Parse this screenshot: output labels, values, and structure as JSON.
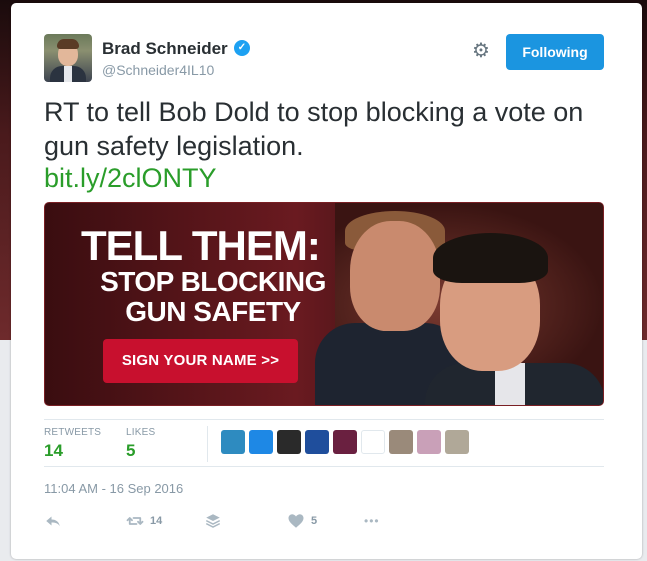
{
  "author": {
    "name": "Brad Schneider",
    "handle": "@Schneider4IL10",
    "verified_icon": "verified-badge-icon",
    "verified_glyph": "✓"
  },
  "header": {
    "settings_icon": "gear-icon",
    "settings_glyph": "⚙",
    "follow_label": "Following"
  },
  "tweet": {
    "text": "RT to tell Bob Dold to stop blocking a vote on gun safety legislation.",
    "link": "bit.ly/2clONTY"
  },
  "media": {
    "headline": "TELL THEM:",
    "subhead_line1": "STOP BLOCKING",
    "subhead_line2": "GUN SAFETY",
    "button_label": "SIGN YOUR NAME >>"
  },
  "stats": {
    "retweets_label": "RETWEETS",
    "retweets_value": "14",
    "likes_label": "LIKES",
    "likes_value": "5"
  },
  "likers": [
    {
      "name": "liker-avatar-1",
      "color": "#2e8bc0"
    },
    {
      "name": "liker-avatar-2",
      "color": "#1e88e5"
    },
    {
      "name": "liker-avatar-3",
      "color": "#2a2a2a"
    },
    {
      "name": "liker-avatar-4",
      "color": "#1f4e9c"
    },
    {
      "name": "liker-avatar-5",
      "color": "#6a2040"
    },
    {
      "name": "liker-avatar-6",
      "color": "#ffffff"
    },
    {
      "name": "liker-avatar-7",
      "color": "#9a8a7a"
    },
    {
      "name": "liker-avatar-8",
      "color": "#c9a0b8"
    },
    {
      "name": "liker-avatar-9",
      "color": "#b0a898"
    }
  ],
  "timestamp": "11:04 AM - 16 Sep 2016",
  "actions": {
    "reply_icon": "reply-icon",
    "retweet_icon": "retweet-icon",
    "retweet_count": "14",
    "buffer_icon": "buffer-stack-icon",
    "like_icon": "heart-icon",
    "like_count": "5",
    "more_icon": "more-dots-icon",
    "more_glyph": "•••"
  },
  "colors": {
    "accent_blue": "#1b95e0",
    "link_green": "#2a9d2a",
    "media_red": "#c8102e"
  }
}
